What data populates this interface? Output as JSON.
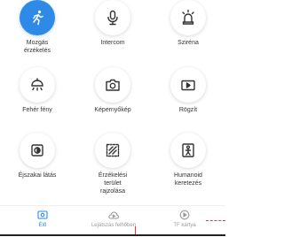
{
  "features": [
    {
      "label": "Mozgás\nérzékelés",
      "icon": "running-person-icon",
      "active": true
    },
    {
      "label": "Intercom",
      "icon": "microphone-icon",
      "active": false
    },
    {
      "label": "Sziréna",
      "icon": "siren-icon",
      "active": false
    },
    {
      "label": "Fehér fény",
      "icon": "white-light-icon",
      "active": false
    },
    {
      "label": "Képernyőkép",
      "icon": "camera-icon",
      "active": false
    },
    {
      "label": "Rögzít",
      "icon": "record-icon",
      "active": false
    },
    {
      "label": "Éjszakai látás",
      "icon": "night-vision-icon",
      "active": false
    },
    {
      "label": "Érzékelési\nterület\nrajzolása",
      "icon": "draw-area-icon",
      "active": false
    },
    {
      "label": "Humanoid\nkeretezés",
      "icon": "humanoid-frame-icon",
      "active": false
    }
  ],
  "tabs": [
    {
      "label": "Élő",
      "icon": "live-icon",
      "active": true
    },
    {
      "label": "Lejátszás felhőben",
      "icon": "cloud-playback-icon",
      "active": false
    },
    {
      "label": "TF kártya",
      "icon": "tf-card-icon",
      "active": false
    }
  ],
  "colors": {
    "accent": "#2e8ae6",
    "icon": "#333333",
    "muted": "#9a9a9a",
    "marker": "#e53935"
  }
}
